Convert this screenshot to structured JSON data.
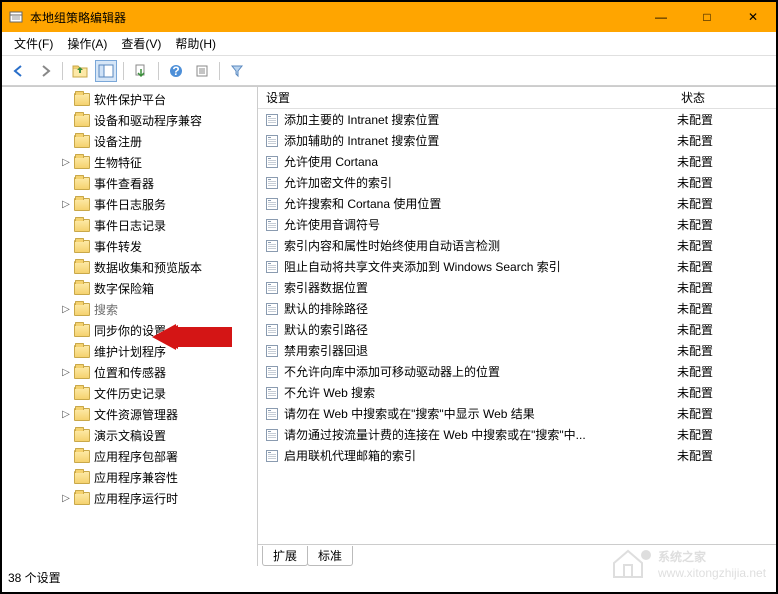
{
  "window": {
    "title": "本地组策略编辑器",
    "minimize": "—",
    "maximize": "□",
    "close": "✕"
  },
  "menu": {
    "file": "文件(F)",
    "action": "操作(A)",
    "view": "查看(V)",
    "help": "帮助(H)"
  },
  "toolbar_icons": {
    "back": "back-icon",
    "forward": "forward-icon",
    "up": "up-icon",
    "window": "window-icon",
    "export": "export-icon",
    "help": "help-icon",
    "props": "props-icon",
    "filter": "filter-icon"
  },
  "tree": {
    "items": [
      {
        "label": "软件保护平台",
        "expander": "none"
      },
      {
        "label": "设备和驱动程序兼容",
        "expander": "none"
      },
      {
        "label": "设备注册",
        "expander": "none"
      },
      {
        "label": "生物特征",
        "expander": "collapsed"
      },
      {
        "label": "事件查看器",
        "expander": "none"
      },
      {
        "label": "事件日志服务",
        "expander": "collapsed"
      },
      {
        "label": "事件日志记录",
        "expander": "none"
      },
      {
        "label": "事件转发",
        "expander": "none"
      },
      {
        "label": "数据收集和预览版本",
        "expander": "none"
      },
      {
        "label": "数字保险箱",
        "expander": "none"
      },
      {
        "label": "搜索",
        "expander": "collapsed",
        "selected": true
      },
      {
        "label": "同步你的设置",
        "expander": "none"
      },
      {
        "label": "维护计划程序",
        "expander": "none"
      },
      {
        "label": "位置和传感器",
        "expander": "collapsed"
      },
      {
        "label": "文件历史记录",
        "expander": "none"
      },
      {
        "label": "文件资源管理器",
        "expander": "collapsed"
      },
      {
        "label": "演示文稿设置",
        "expander": "none"
      },
      {
        "label": "应用程序包部署",
        "expander": "none"
      },
      {
        "label": "应用程序兼容性",
        "expander": "none"
      },
      {
        "label": "应用程序运行时",
        "expander": "collapsed"
      }
    ]
  },
  "list": {
    "header_setting": "设置",
    "header_status": "状态",
    "rows": [
      {
        "setting": "添加主要的 Intranet 搜索位置",
        "status": "未配置"
      },
      {
        "setting": "添加辅助的 Intranet 搜索位置",
        "status": "未配置"
      },
      {
        "setting": "允许使用 Cortana",
        "status": "未配置"
      },
      {
        "setting": "允许加密文件的索引",
        "status": "未配置"
      },
      {
        "setting": "允许搜索和 Cortana 使用位置",
        "status": "未配置"
      },
      {
        "setting": "允许使用音调符号",
        "status": "未配置"
      },
      {
        "setting": "索引内容和属性时始终使用自动语言检测",
        "status": "未配置"
      },
      {
        "setting": "阻止自动将共享文件夹添加到 Windows Search 索引",
        "status": "未配置"
      },
      {
        "setting": "索引器数据位置",
        "status": "未配置"
      },
      {
        "setting": "默认的排除路径",
        "status": "未配置"
      },
      {
        "setting": "默认的索引路径",
        "status": "未配置"
      },
      {
        "setting": "禁用索引器回退",
        "status": "未配置"
      },
      {
        "setting": "不允许向库中添加可移动驱动器上的位置",
        "status": "未配置"
      },
      {
        "setting": "不允许 Web 搜索",
        "status": "未配置"
      },
      {
        "setting": "请勿在 Web 中搜索或在\"搜索\"中显示 Web 结果",
        "status": "未配置"
      },
      {
        "setting": "请勿通过按流量计费的连接在 Web 中搜索或在\"搜索\"中...",
        "status": "未配置"
      },
      {
        "setting": "启用联机代理邮箱的索引",
        "status": "未配置"
      }
    ]
  },
  "tabs": {
    "extended": "扩展",
    "standard": "标准"
  },
  "statusbar": {
    "count": "38 个设置"
  },
  "watermark": {
    "text": "系统之家",
    "url": "www.xitongzhijia.net"
  }
}
